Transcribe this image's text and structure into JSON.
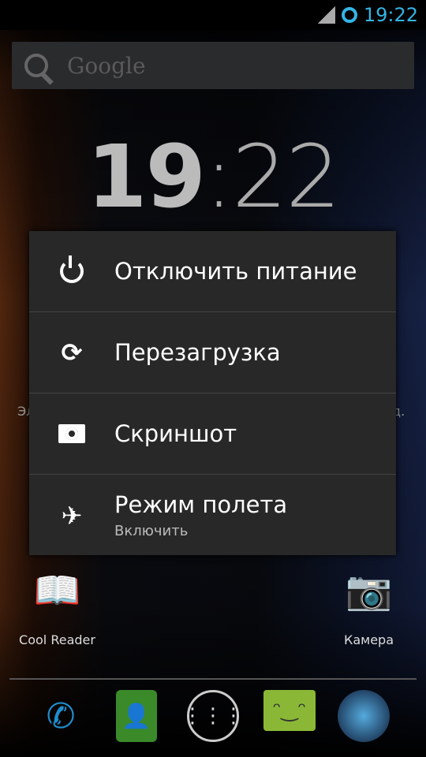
{
  "status_bar": {
    "time": "19:22",
    "signal_icon": "signal-icon",
    "sync_icon": "ring-icon",
    "accent": "#33b5e5"
  },
  "search": {
    "placeholder": "Google"
  },
  "clock": {
    "hours": "19",
    "separator": ":",
    "minutes": "22"
  },
  "background_labels": {
    "left": "Эл",
    "right": "д."
  },
  "power_menu": {
    "items": [
      {
        "icon": "power-icon",
        "label": "Отключить питание"
      },
      {
        "icon": "restart-icon",
        "label": "Перезагрузка"
      },
      {
        "icon": "camera-icon",
        "label": "Скриншот"
      },
      {
        "icon": "airplane-icon",
        "label": "Режим полета",
        "sublabel": "Включить"
      }
    ]
  },
  "apps": [
    {
      "label": "Cool Reader"
    },
    {
      "label": "Камера"
    }
  ],
  "dock": [
    "phone",
    "contacts",
    "all-apps",
    "messaging",
    "browser"
  ]
}
